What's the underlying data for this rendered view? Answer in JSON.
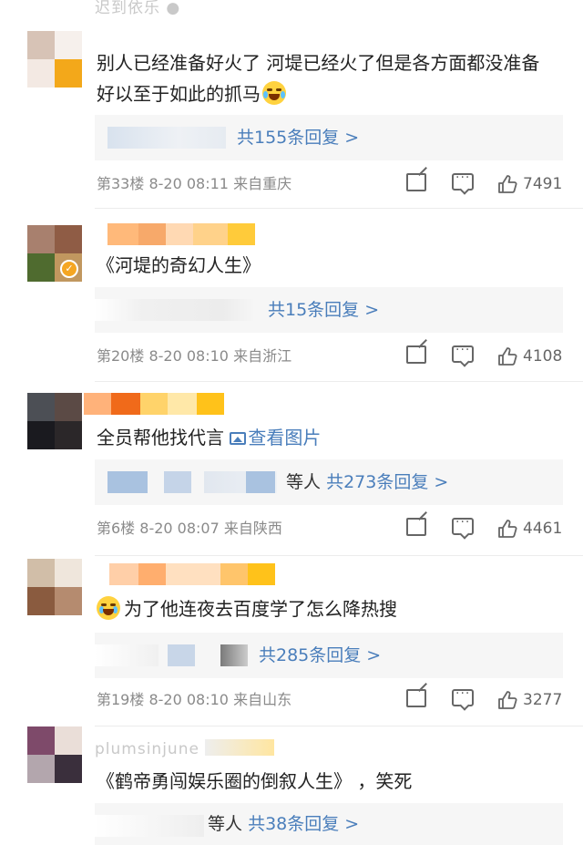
{
  "comments": [
    {
      "username_visible": "迟到依乐 ●",
      "text": "别人已经准备好火了 河堤已经火了但是各方面都没准备好以至于如此的抓马",
      "reply": {
        "prefix": "",
        "summary": "共155条回复 >"
      },
      "floor": "第33楼",
      "time": "8-20 08:11",
      "location": "来自重庆",
      "likes": "7491",
      "avatar_colors": [
        "#d7c3b6",
        "#f6f0ec",
        "#f3e9e3",
        "#f3a81a"
      ],
      "name_colors": [
        "#d9d9d9"
      ]
    },
    {
      "username_visible": "",
      "text": "《河堤的奇幻人生》",
      "reply": {
        "prefix": "",
        "summary": "共15条回复 >"
      },
      "floor": "第20楼",
      "time": "8-20 08:10",
      "location": "来自浙江",
      "likes": "4108",
      "verified": true,
      "avatar_colors": [
        "#a8806e",
        "#8f5c45",
        "#4f6b2f",
        "#c1975f"
      ],
      "name_colors": [
        "#ffb97a",
        "#f7a96a",
        "#ffd9b3",
        "#ffd28a",
        "#ffcb3a"
      ]
    },
    {
      "username_visible": "",
      "text": "全员帮他找代言",
      "image_link": "查看图片",
      "reply": {
        "prefix": "等人",
        "summary": "共273条回复 >"
      },
      "floor": "第6楼",
      "time": "8-20 08:07",
      "location": "来自陕西",
      "likes": "4461",
      "avatar_colors": [
        "#4c4f55",
        "#5b4a45",
        "#1a1a1f",
        "#2b2729"
      ],
      "name_colors": [
        "#ffb27a",
        "#f06a1a",
        "#ffd36a",
        "#ffe8a8",
        "#ffc21a"
      ]
    },
    {
      "username_visible": "",
      "text": "为了他连夜去百度学了怎么降热搜",
      "reply": {
        "prefix": "",
        "summary": "共285条回复 >"
      },
      "floor": "第19楼",
      "time": "8-20 08:10",
      "location": "来自山东",
      "likes": "3277",
      "avatar_colors": [
        "#d1bea8",
        "#efe6dc",
        "#8a5b3f",
        "#b58b6f"
      ],
      "name_colors": [
        "#ffcfa8",
        "#ffae6e",
        "#ffe0c0",
        "#ffc56b",
        "#ffc21a"
      ]
    },
    {
      "username_visible": "plumsinjune",
      "text": "《鹤帝勇闯娱乐圈的倒叙人生》 ，笑死",
      "reply": {
        "prefix": "等人",
        "summary": "共38条回复 >"
      },
      "floor": "",
      "time": "",
      "location": "",
      "likes": "",
      "avatar_colors": [
        "#7e4a6a",
        "#eaded8",
        "#b3a6ad",
        "#3a2f3c"
      ],
      "name_colors": [
        "#e9e9e9",
        "#ffe6a0"
      ]
    }
  ],
  "icons": {
    "share": "share-icon",
    "comment": "comment-icon",
    "like": "thumbs-up-icon"
  },
  "colors": {
    "link": "#4a7ebb",
    "meta": "#8a8a8a",
    "reply_bg": "#f6f6f6"
  }
}
